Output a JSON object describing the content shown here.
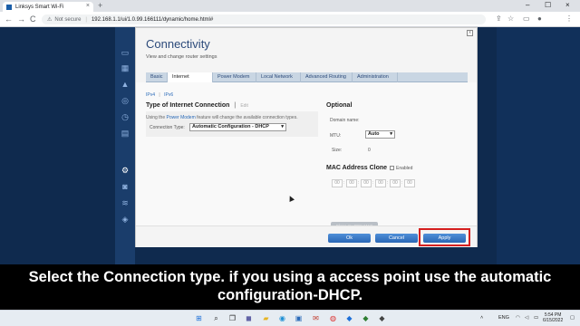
{
  "browser": {
    "tab_title": "Linksys Smart Wi-Fi",
    "tab_close": "×",
    "new_tab": "+",
    "security_label": "Not secure",
    "url": "192.168.1.1/ui/1.0.99.166111/dynamic/home.html#",
    "nav": {
      "back": "←",
      "forward": "→",
      "reload": "C"
    },
    "window_controls": {
      "minimize": "–",
      "maximize": "☐",
      "close": "×"
    }
  },
  "dialog": {
    "title": "Connectivity",
    "subtitle": "View and change router settings",
    "close": "x",
    "tabs": [
      "Basic",
      "Internet Settings",
      "Power Modem",
      "Local Network",
      "Advanced Routing",
      "Administration"
    ],
    "active_tab": "Internet Settings",
    "ip_tabs": {
      "v4": "IPv4",
      "sep": "|",
      "v6": "IPv6"
    },
    "internet_section": {
      "title": "Type of Internet Connection",
      "edit": "Edit",
      "note_pre": "Using the ",
      "note_link": "Power Modem",
      "note_post": " feature will change the available connection types.",
      "connection_type_label": "Connection Type:",
      "connection_type_value": "Automatic Configuration - DHCP"
    },
    "optional_section": {
      "title": "Optional",
      "domain_label": "Domain name:",
      "mtu_label": "MTU:",
      "mtu_value": "Auto",
      "size_label": "Size:",
      "size_value": "0"
    },
    "mac_section": {
      "title": "MAC Address Clone",
      "enabled_label": "Enabled",
      "fields": [
        "00",
        "00",
        "00",
        "00",
        "00",
        "00"
      ],
      "clone_button": "Clone my PC's MAC"
    },
    "buttons": {
      "ok": "Ok",
      "cancel": "Cancel",
      "apply": "Apply"
    }
  },
  "caption": {
    "line1": "Select the Connection type. if you using a access point use the automatic",
    "line2": "configuration-DHCP."
  },
  "taskbar": {
    "language": "ENG",
    "time": "5:54 PM",
    "date": "6/15/2022"
  }
}
